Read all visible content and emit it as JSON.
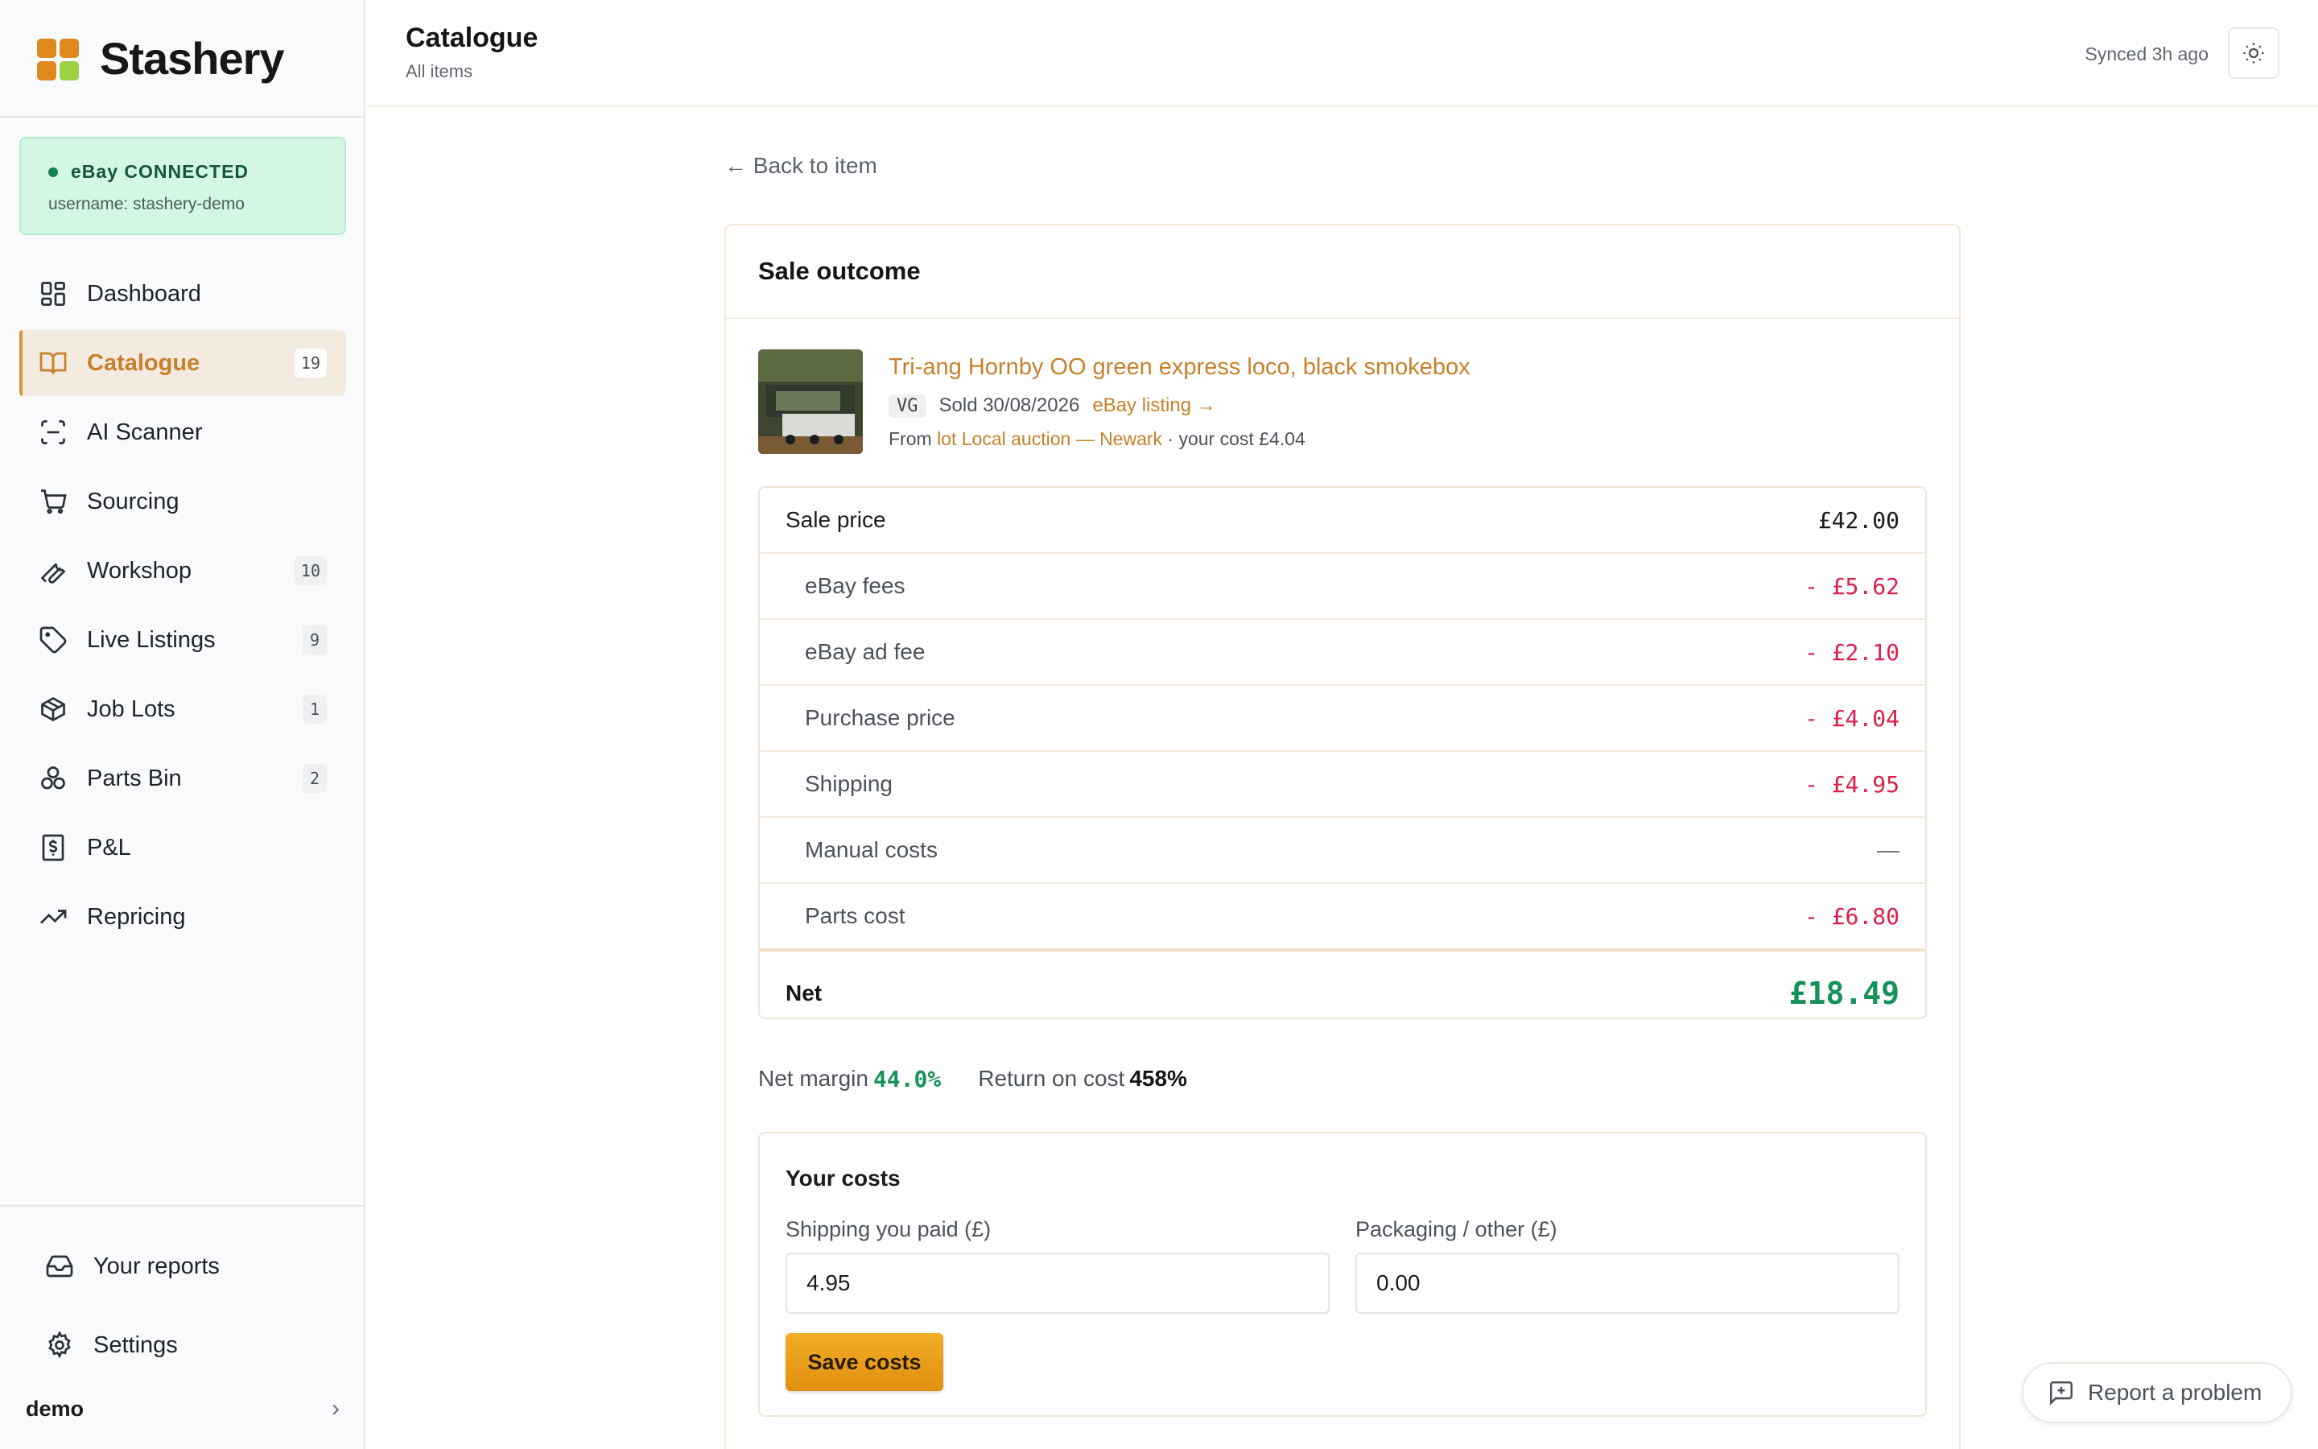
{
  "app": {
    "name": "Stashery"
  },
  "colors": {
    "accent": "#c8802a",
    "positive": "#15925a",
    "negative": "#dc1f4a",
    "connected_bg": "#d4f7e3",
    "logo": [
      "#e08a1e",
      "#e08a1e",
      "#e08a1e",
      "#9ed043"
    ]
  },
  "ebay": {
    "status": "eBay CONNECTED",
    "username": "username: stashery-demo"
  },
  "sidebar": {
    "items": [
      {
        "label": "Dashboard",
        "icon": "dashboard-icon",
        "badge": ""
      },
      {
        "label": "Catalogue",
        "icon": "book-icon",
        "badge": "19",
        "active": true
      },
      {
        "label": "AI Scanner",
        "icon": "scan-icon",
        "badge": ""
      },
      {
        "label": "Sourcing",
        "icon": "cart-icon",
        "badge": ""
      },
      {
        "label": "Workshop",
        "icon": "wrench-icon",
        "badge": "10"
      },
      {
        "label": "Live Listings",
        "icon": "tag-icon",
        "badge": "9"
      },
      {
        "label": "Job Lots",
        "icon": "package-icon",
        "badge": "1"
      },
      {
        "label": "Parts Bin",
        "icon": "parts-icon",
        "badge": "2"
      },
      {
        "label": "P&L",
        "icon": "receipt-icon",
        "badge": ""
      },
      {
        "label": "Repricing",
        "icon": "trend-icon",
        "badge": ""
      }
    ],
    "bottom": [
      {
        "label": "Your reports",
        "icon": "inbox-icon"
      },
      {
        "label": "Settings",
        "icon": "gear-icon"
      }
    ],
    "user": "demo"
  },
  "header": {
    "title": "Catalogue",
    "subtitle": "All items",
    "synced": "Synced 3h ago"
  },
  "main": {
    "back_link": "← Back to item",
    "card_title": "Sale outcome",
    "item": {
      "title": "Tri-ang Hornby OO green express loco, black smokebox",
      "grade": "VG",
      "sold": "Sold 30/08/2026",
      "listing_link": "eBay listing →",
      "from_prefix": "From ",
      "lot": "lot Local auction — Newark",
      "cost_note": " · your cost £4.04"
    },
    "ledger": [
      {
        "label": "Sale price",
        "value": "£42.00",
        "kind": "head"
      },
      {
        "label": "eBay fees",
        "value": "- £5.62",
        "kind": "neg"
      },
      {
        "label": "eBay ad fee",
        "value": "- £2.10",
        "kind": "neg"
      },
      {
        "label": "Purchase price",
        "value": "- £4.04",
        "kind": "neg"
      },
      {
        "label": "Shipping",
        "value": "- £4.95",
        "kind": "neg"
      },
      {
        "label": "Manual costs",
        "value": "—",
        "kind": "dash"
      },
      {
        "label": "Parts cost",
        "value": "- £6.80",
        "kind": "neg"
      }
    ],
    "net": {
      "label": "Net",
      "value": "£18.49"
    },
    "ratios": {
      "margin_label": "Net margin",
      "margin_value": "44.0%",
      "roc_label": "Return on cost",
      "roc_value": "458%"
    },
    "costs": {
      "title": "Your costs",
      "shipping_label": "Shipping you paid (£)",
      "shipping_value": "4.95",
      "packaging_label": "Packaging / other (£)",
      "packaging_value": "0.00",
      "save_label": "Save costs"
    }
  },
  "report_button": "Report a problem"
}
